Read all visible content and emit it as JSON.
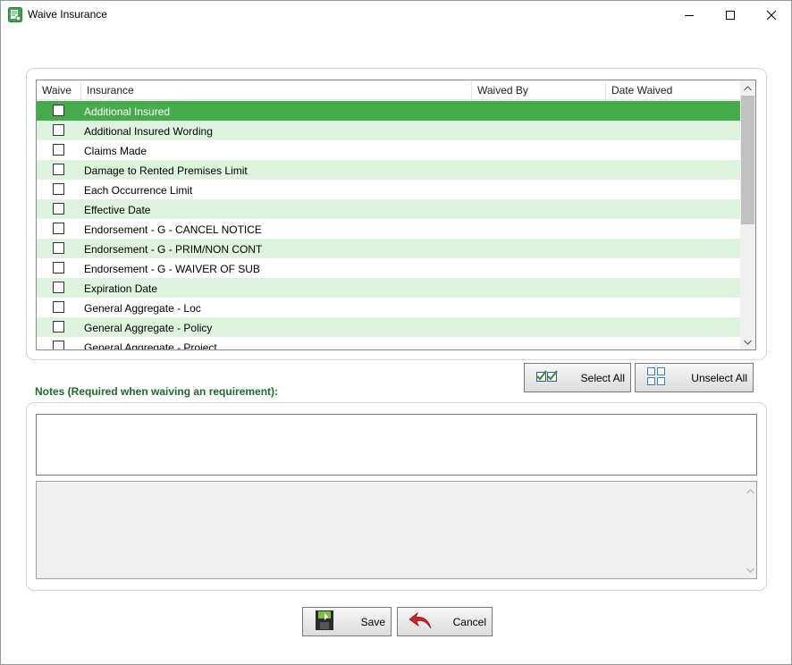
{
  "window": {
    "title": "Waive Insurance"
  },
  "grid": {
    "columns": [
      "Waive",
      "Insurance",
      "Waived By",
      "Date Waived"
    ],
    "rows": [
      {
        "insurance": "Additional Insured",
        "selected": true
      },
      {
        "insurance": "Additional Insured Wording"
      },
      {
        "insurance": "Claims Made"
      },
      {
        "insurance": "Damage to Rented Premises Limit"
      },
      {
        "insurance": "Each Occurrence Limit"
      },
      {
        "insurance": "Effective Date"
      },
      {
        "insurance": "Endorsement - G - CANCEL NOTICE"
      },
      {
        "insurance": "Endorsement - G - PRIM/NON CONT"
      },
      {
        "insurance": "Endorsement - G - WAIVER OF SUB"
      },
      {
        "insurance": "Expiration Date"
      },
      {
        "insurance": "General Aggregate - Loc"
      },
      {
        "insurance": "General Aggregate - Policy"
      },
      {
        "insurance": "General Aggregate - Project"
      }
    ]
  },
  "actions": {
    "select_all": "Select All",
    "unselect_all": "Unselect All"
  },
  "notes": {
    "label": "Notes (Required when waiving an requirement):",
    "input_value": "",
    "history_value": ""
  },
  "footer": {
    "save": "Save",
    "cancel": "Cancel"
  },
  "colors": {
    "selected_row": "#46ab4a",
    "alt_row": "#def3de",
    "notes_label": "#1f6a2a"
  }
}
